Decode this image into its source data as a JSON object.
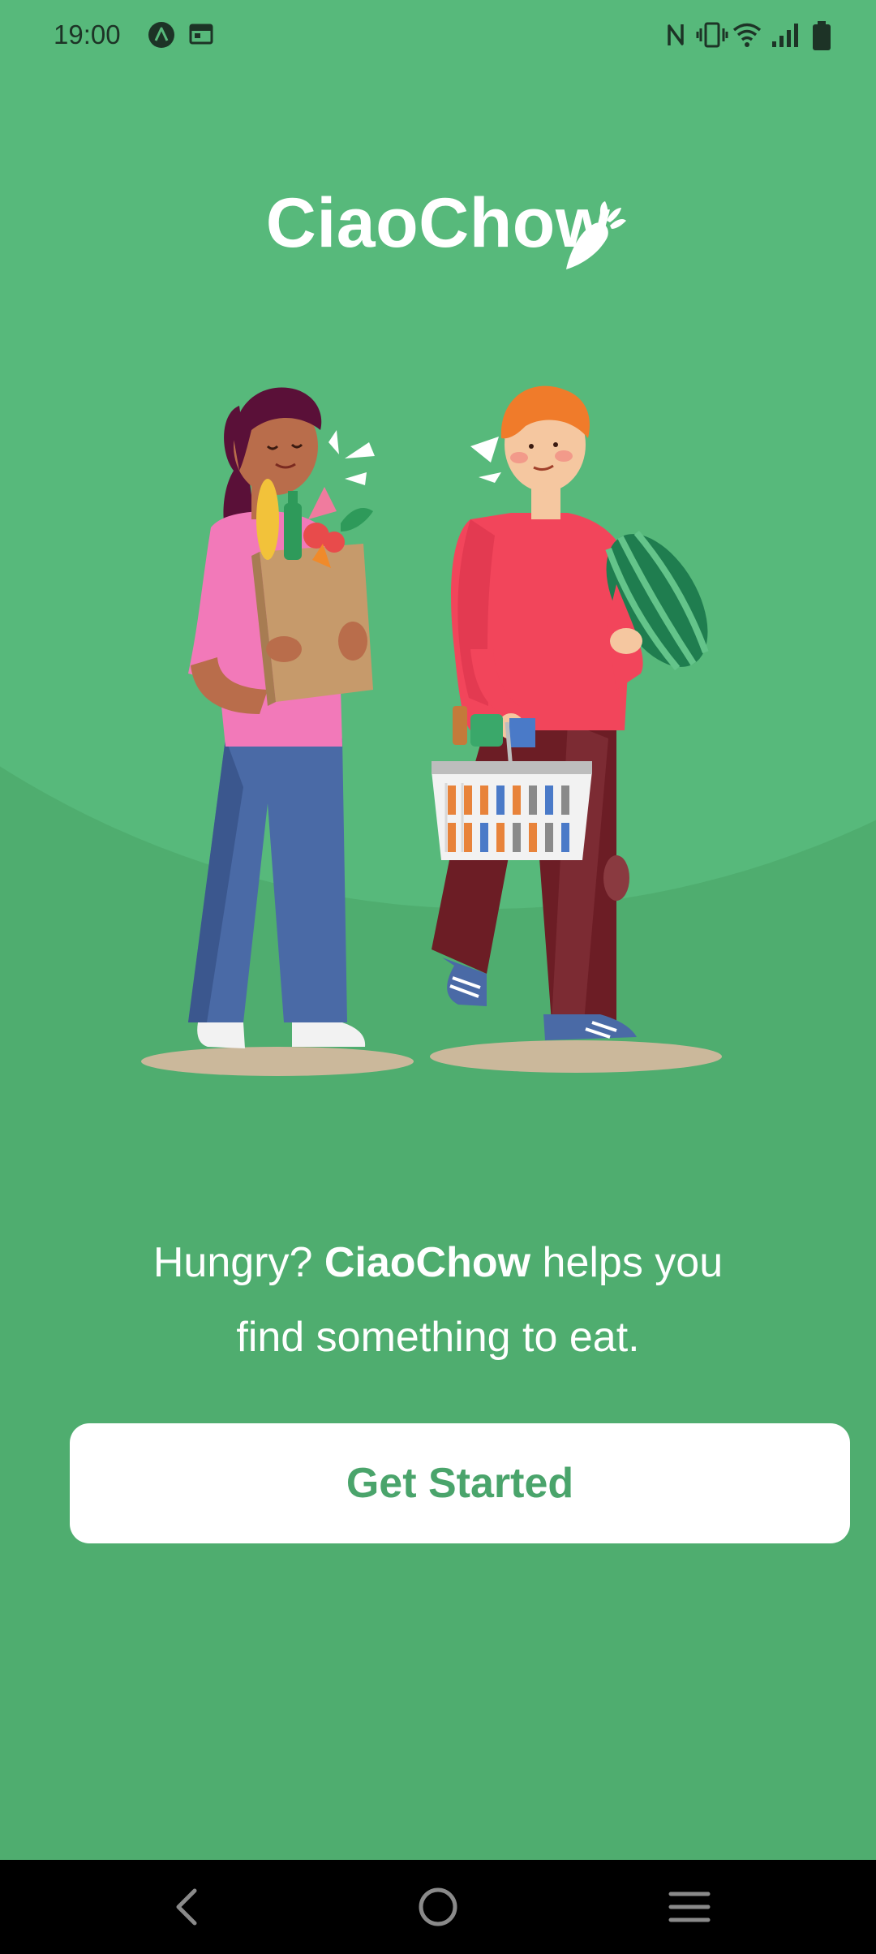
{
  "status_bar": {
    "time": "19:00",
    "left_icons": [
      "app-notification-icon",
      "calendar-notification-icon"
    ],
    "right_icons": [
      "nfc-icon",
      "vibrate-icon",
      "wifi-icon",
      "cell-signal-icon",
      "battery-icon"
    ]
  },
  "brand": {
    "name": "CiaoChow",
    "logo_icon": "carrot-icon"
  },
  "hero": {
    "illustration": "shoppers-with-groceries-illustration"
  },
  "tagline": {
    "prefix": "Hungry? ",
    "brand": "CiaoChow",
    "suffix": " helps you find something to eat."
  },
  "cta": {
    "label": "Get Started"
  },
  "nav_bar": {
    "back": "back-icon",
    "home": "home-icon",
    "recents": "menu-icon"
  },
  "colors": {
    "background": "#4fad6f",
    "background_light": "#57b97b",
    "button_bg": "#ffffff",
    "button_text": "#4aa46b",
    "text": "#ffffff"
  }
}
